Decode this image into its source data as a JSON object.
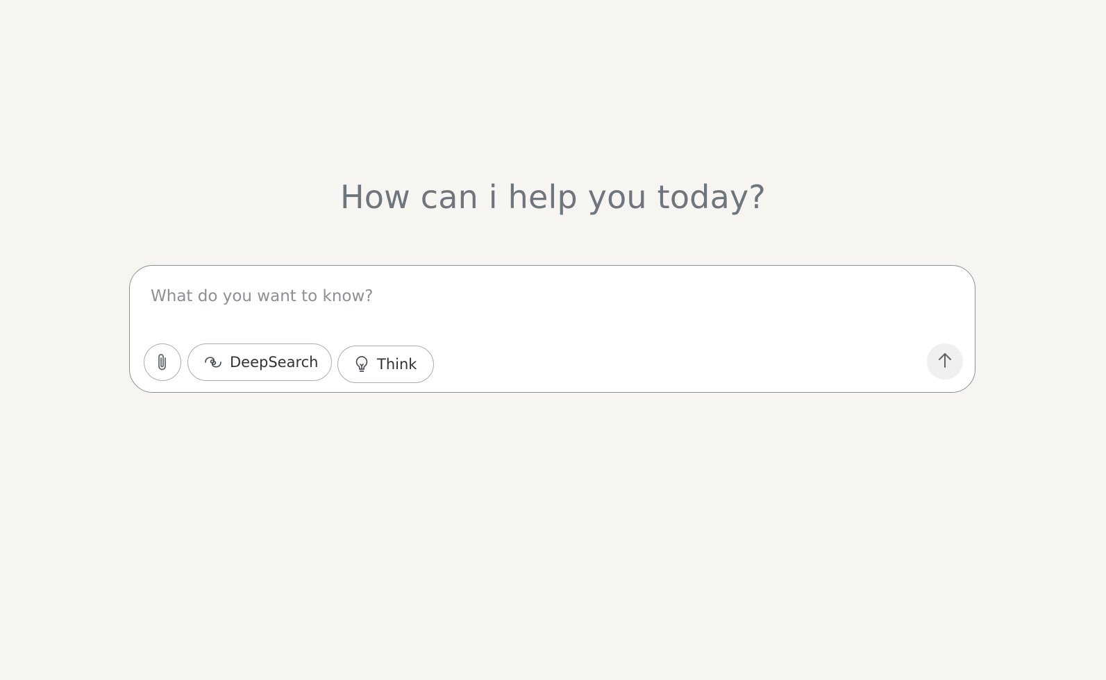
{
  "heading": {
    "text": "How can i help you today?"
  },
  "composer": {
    "input_placeholder": "What do you want to know?",
    "input_value": "",
    "buttons": {
      "attach_icon": "paperclip-icon",
      "deepsearch_label": "DeepSearch",
      "deepsearch_icon": "swirl-icon",
      "think_label": "Think",
      "think_icon": "lightbulb-icon",
      "send_icon": "arrow-up-icon"
    }
  },
  "colors": {
    "background": "#f6f5f2",
    "heading_text": "#6f757c",
    "composer_border": "#8b8f95",
    "send_button_bg": "#f0f0ee"
  }
}
